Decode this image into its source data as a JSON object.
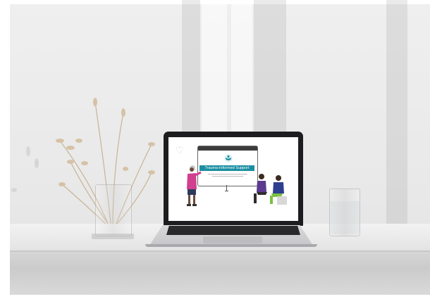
{
  "photo": {
    "subject": "laptop-on-desk",
    "slide": {
      "title": "Trauma-Informed Support",
      "accent_color": "#1a8ea2",
      "heart_icon": "heart-outline-icon"
    },
    "colors": {
      "wall": "#ececec",
      "desk": "#eaeaea",
      "laptop_frame": "#1d1d1f",
      "figure_pink": "#d13f8f",
      "figure_purple": "#5b3a8f",
      "figure_green": "#7ac043"
    }
  }
}
